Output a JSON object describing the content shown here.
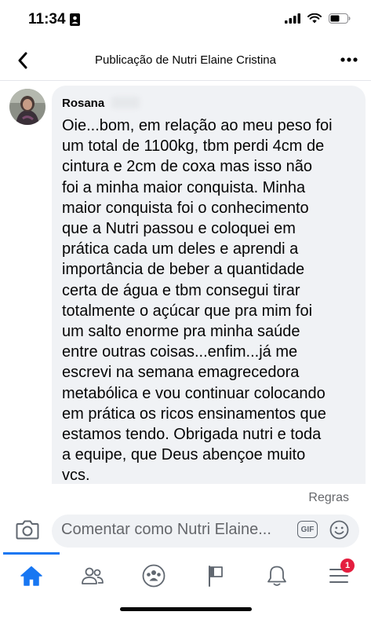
{
  "status_bar": {
    "time": "11:34"
  },
  "header": {
    "title": "Publicação de Nutri Elaine Cristina",
    "back_icon": "chevron-left-icon",
    "more_icon": "more-dots-icon"
  },
  "comment": {
    "author": "Rosana",
    "text": "Oie...bom, em relação ao meu peso foi\num total de 1100kg, tbm perdi 4cm de\ncintura e 2cm de coxa mas isso não\nfoi a minha maior conquista. Minha\nmaior conquista foi o conhecimento\nque a Nutri passou e coloquei em\nprática cada um deles e aprendi a\nimportância de beber a quantidade\ncerta de água e tbm consegui tirar\ntotalmente o açúcar que pra mim foi\num salto enorme pra minha saúde\nentre outras coisas...enfim...já me\nescrevi na semana emagrecedora\nmetabólica e vou continuar colocando\nem prática os ricos ensinamentos que\nestamos tendo. Obrigada nutri e toda\na equipe, que Deus abençoe muito\nvcs."
  },
  "rules_link": "Regras",
  "composer": {
    "placeholder": "Comentar como Nutri Elaine...",
    "gif_label": "GIF"
  },
  "tab_bar": {
    "items": [
      {
        "icon": "home-icon",
        "active": true
      },
      {
        "icon": "friends-icon",
        "active": false
      },
      {
        "icon": "groups-icon",
        "active": false
      },
      {
        "icon": "pages-flag-icon",
        "active": false
      },
      {
        "icon": "notifications-bell-icon",
        "active": false
      },
      {
        "icon": "menu-icon",
        "active": false,
        "badge": "1"
      }
    ]
  },
  "colors": {
    "accent": "#1877f2",
    "bubble": "#f0f2f5",
    "secondary_text": "#65676b",
    "badge": "#e41e3f"
  }
}
